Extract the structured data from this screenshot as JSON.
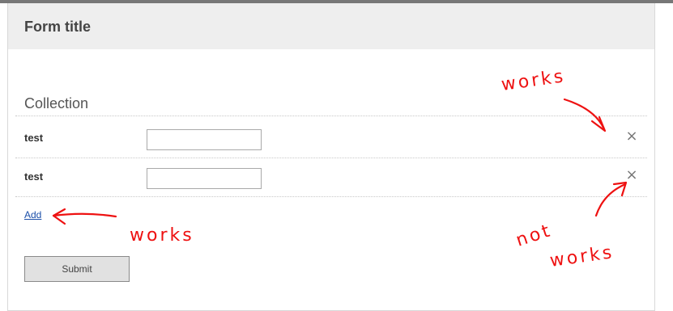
{
  "form": {
    "title": "Form title",
    "collection_title": "Collection",
    "rows": [
      {
        "label": "test",
        "value": "",
        "remove_icon": "×"
      },
      {
        "label": "test",
        "value": "",
        "remove_icon": "×"
      }
    ],
    "add_label": "Add",
    "submit_label": "Submit"
  },
  "annotations": {
    "top_right": "works",
    "bottom_left": "works",
    "bottom_right_line1": "not",
    "bottom_right_line2": "works",
    "color": "#ee1111"
  }
}
